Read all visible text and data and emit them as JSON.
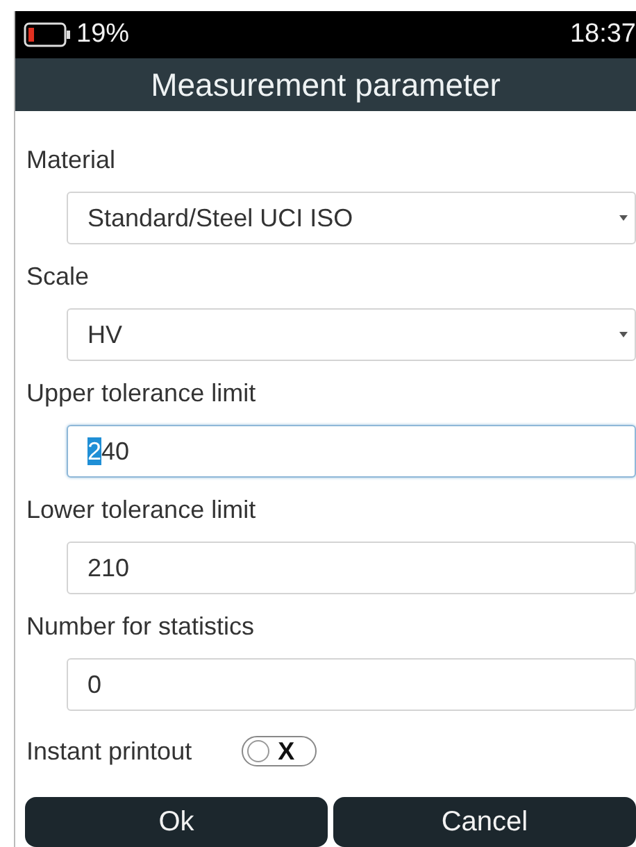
{
  "status_bar": {
    "battery": "19%",
    "time": "18:37"
  },
  "title": "Measurement parameter",
  "fields": [
    {
      "label": "Material",
      "kind": "dropdown",
      "value": "Standard/Steel UCI ISO",
      "focused": false
    },
    {
      "label": "Scale",
      "kind": "dropdown",
      "value": "HV",
      "focused": false
    },
    {
      "label": "Upper tolerance limit",
      "kind": "input",
      "value": "240",
      "focused": true
    },
    {
      "label": "Lower tolerance limit",
      "kind": "input",
      "value": "210",
      "focused": false
    },
    {
      "label": "Number for statistics",
      "kind": "input",
      "value": "0",
      "focused": false
    }
  ],
  "instant_printout": {
    "label": "Instant printout",
    "on": false,
    "glyph": "X"
  },
  "buttons": [
    "Ok",
    "Cancel"
  ]
}
